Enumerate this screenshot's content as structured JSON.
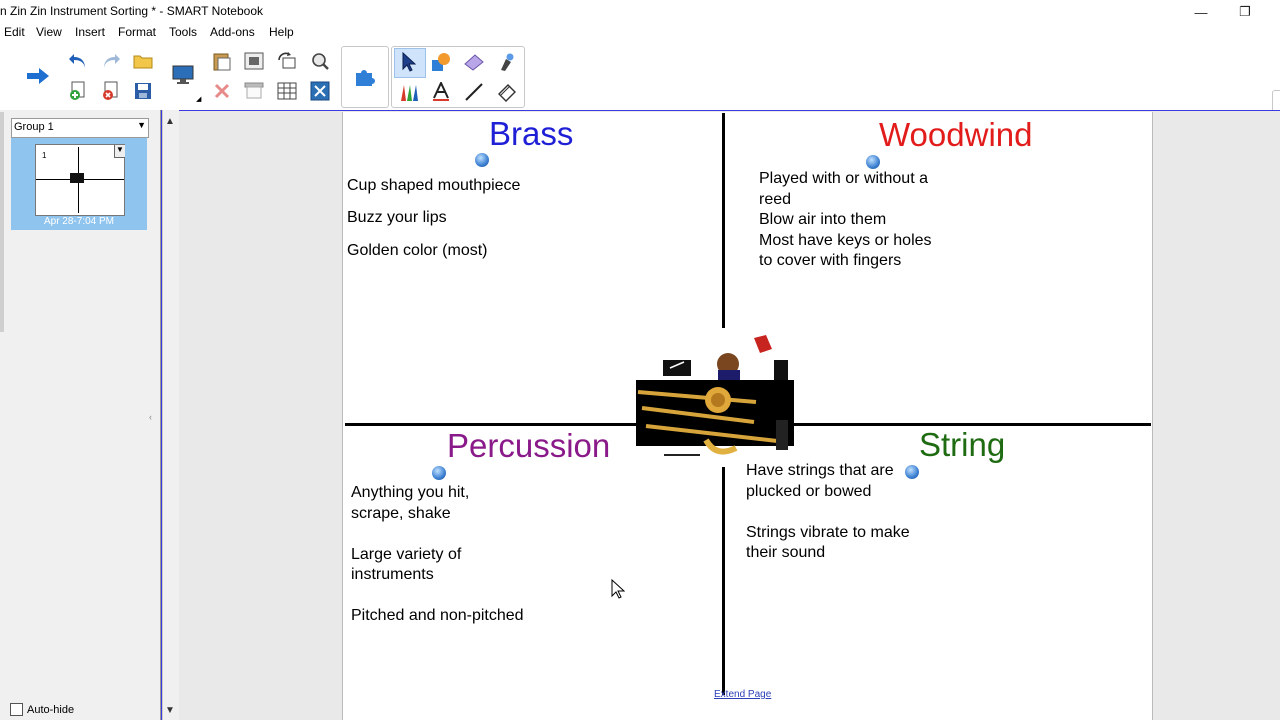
{
  "window": {
    "title": "n Zin Zin Instrument Sorting * - SMART Notebook",
    "minimize_icon": "—",
    "restore_icon": "❐"
  },
  "menu": [
    "Edit",
    "View",
    "Insert",
    "Format",
    "Tools",
    "Add-ons",
    "Help"
  ],
  "toolbar": {
    "groups": [
      [
        "back-icon"
      ],
      [
        "undo-icon",
        "redo-icon",
        "open-folder-icon",
        "add-page-icon",
        "delete-page-icon",
        "save-icon"
      ],
      [
        "screen-display-icon"
      ],
      [
        "paste-icon",
        "screen-capture-icon",
        "rotate-icon",
        "zoom-icon",
        "delete-icon",
        "screen-shade-icon",
        "table-icon",
        "full-screen-icon"
      ],
      [
        "add-ons-puzzle-icon"
      ],
      [
        "select-arrow-icon",
        "shapes-icon",
        "eraser-icon",
        "magic-pen-icon",
        "pens-icon",
        "text-icon",
        "line-icon",
        "fill-icon"
      ]
    ]
  },
  "sidebar": {
    "group_label": "Group 1",
    "thumbnail_label": "Apr 28-7:04 PM",
    "autohide_label": "Auto-hide"
  },
  "page": {
    "quadrants": {
      "brass": {
        "title": "Brass",
        "color": "#1f1fd6",
        "lines": [
          "Cup shaped mouthpiece",
          "Buzz your lips",
          "Golden color (most)"
        ]
      },
      "woodwind": {
        "title": "Woodwind",
        "color": "#e21b1b",
        "text": "Played with or without a\nreed\nBlow air into them\nMost have keys or holes\nto cover with fingers"
      },
      "percussion": {
        "title": "Percussion",
        "color": "#8a1a8a",
        "text": "Anything you hit,\nscrape, shake\n\nLarge variety of\ninstruments\n\nPitched and non-pitched"
      },
      "string": {
        "title": "String",
        "color": "#1e6b12",
        "text": "Have strings that are\nplucked or bowed\n\nStrings vibrate to make\ntheir sound"
      }
    },
    "extend_link": "Extend Page"
  }
}
